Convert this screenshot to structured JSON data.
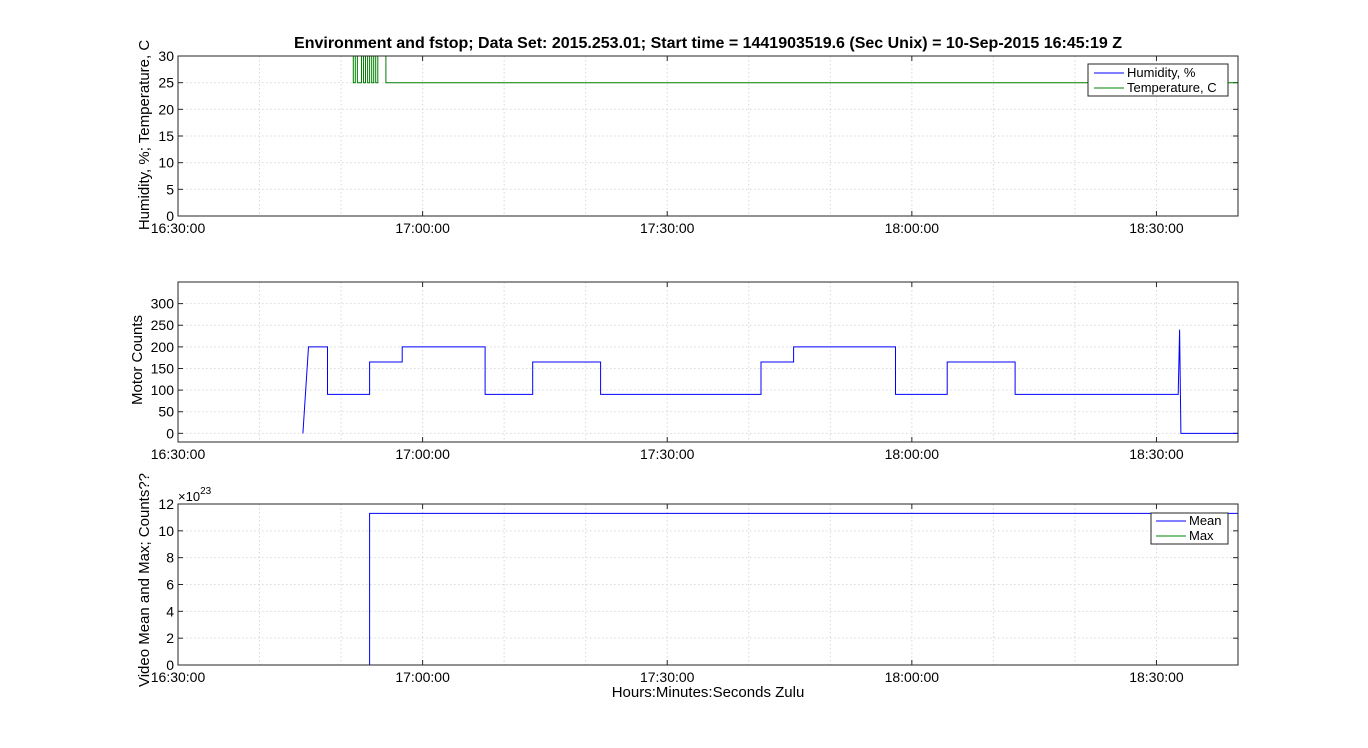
{
  "figure_title": "Environment and fstop; Data Set: 2015.253.01;  Start time = 1441903519.6 (Sec Unix) = 10-Sep-2015 16:45:19 Z",
  "colors": {
    "blue": "#0000ff",
    "green": "#008000",
    "grid": "#d9d9d9",
    "axes": "#262626"
  },
  "chart_data": [
    {
      "type": "line",
      "title": "Environment and fstop; Data Set: 2015.253.01;  Start time = 1441903519.6 (Sec Unix) = 10-Sep-2015 16:45:19 Z",
      "ylabel": "Humidity, %; Temperature, C",
      "xlabel": "",
      "xlim": [
        "16:30:00",
        "18:40:00"
      ],
      "ylim": [
        0,
        30
      ],
      "xticks": [
        "16:30:00",
        "17:00:00",
        "17:30:00",
        "18:00:00",
        "18:30:00"
      ],
      "yticks": [
        "0",
        "5",
        "10",
        "15",
        "20",
        "25",
        "30"
      ],
      "grid": true,
      "legend_position": "top-right",
      "series": [
        {
          "name": "Humidity, %",
          "color": "#0000ff",
          "x": [
            "16:30:00",
            "18:40:00"
          ],
          "y": [
            0,
            0
          ]
        },
        {
          "name": "Temperature, C",
          "color": "#008000",
          "x": [
            "16:45:19",
            "16:51:30",
            "16:51:30",
            "16:51:45",
            "16:51:45",
            "16:52:00",
            "16:52:00",
            "16:52:30",
            "16:52:30",
            "16:52:45",
            "16:52:45",
            "16:53:00",
            "16:53:00",
            "16:53:15",
            "16:53:15",
            "16:53:30",
            "16:53:30",
            "16:53:45",
            "16:53:45",
            "16:54:00",
            "16:54:00",
            "16:54:15",
            "16:54:15",
            "16:54:30",
            "16:54:30",
            "16:55:30",
            "16:55:30",
            "16:56:00",
            "16:56:00",
            "18:40:00"
          ],
          "y": [
            30,
            30,
            25,
            25,
            30,
            30,
            25,
            25,
            30,
            30,
            25,
            25,
            30,
            30,
            25,
            25,
            30,
            30,
            25,
            25,
            30,
            30,
            25,
            25,
            30,
            30,
            25,
            25,
            25,
            25
          ]
        }
      ]
    },
    {
      "type": "line",
      "ylabel": "Motor Counts",
      "xlabel": "",
      "xlim": [
        "16:30:00",
        "18:40:00"
      ],
      "ylim": [
        -20,
        350
      ],
      "xticks": [
        "16:30:00",
        "17:00:00",
        "17:30:00",
        "18:00:00",
        "18:30:00"
      ],
      "yticks": [
        "0",
        "50",
        "100",
        "150",
        "200",
        "250",
        "300"
      ],
      "grid": true,
      "series": [
        {
          "color": "#0000ff",
          "x": [
            "16:45:19",
            "16:46:00",
            "16:48:20",
            "16:48:20",
            "16:53:30",
            "16:53:30",
            "16:57:30",
            "16:57:30",
            "17:07:40",
            "17:07:40",
            "17:13:30",
            "17:13:30",
            "17:21:50",
            "17:21:50",
            "17:41:30",
            "17:41:30",
            "17:45:30",
            "17:45:30",
            "17:58:00",
            "17:58:00",
            "18:04:20",
            "18:04:20",
            "18:12:40",
            "18:12:40",
            "18:32:40",
            "18:32:50",
            "18:33:00",
            "18:40:00"
          ],
          "y": [
            0,
            200,
            200,
            90,
            90,
            165,
            165,
            200,
            200,
            90,
            90,
            165,
            165,
            90,
            90,
            165,
            165,
            200,
            200,
            90,
            90,
            165,
            165,
            90,
            90,
            240,
            0,
            0
          ]
        }
      ]
    },
    {
      "type": "line",
      "ylabel": "Video Mean and Max; Counts??",
      "xlabel": "Hours:Minutes:Seconds Zulu",
      "xlim": [
        "16:30:00",
        "18:40:00"
      ],
      "ylim": [
        0,
        12
      ],
      "y_scale_factor": "×10^23",
      "exponent_base": "×10",
      "exponent_power": "23",
      "xticks": [
        "16:30:00",
        "17:00:00",
        "17:30:00",
        "18:00:00",
        "18:30:00"
      ],
      "yticks": [
        "0",
        "2",
        "4",
        "6",
        "8",
        "10",
        "12"
      ],
      "grid": true,
      "legend_position": "top-right",
      "series": [
        {
          "name": "Mean",
          "color": "#0000ff",
          "x": [
            "16:30:00",
            "16:53:30",
            "16:53:30",
            "18:40:00"
          ],
          "y": [
            0,
            0,
            11.3,
            11.3
          ]
        },
        {
          "name": "Max",
          "color": "#008000",
          "x": [
            "16:30:00",
            "18:40:00"
          ],
          "y": [
            0,
            0
          ]
        }
      ]
    }
  ]
}
